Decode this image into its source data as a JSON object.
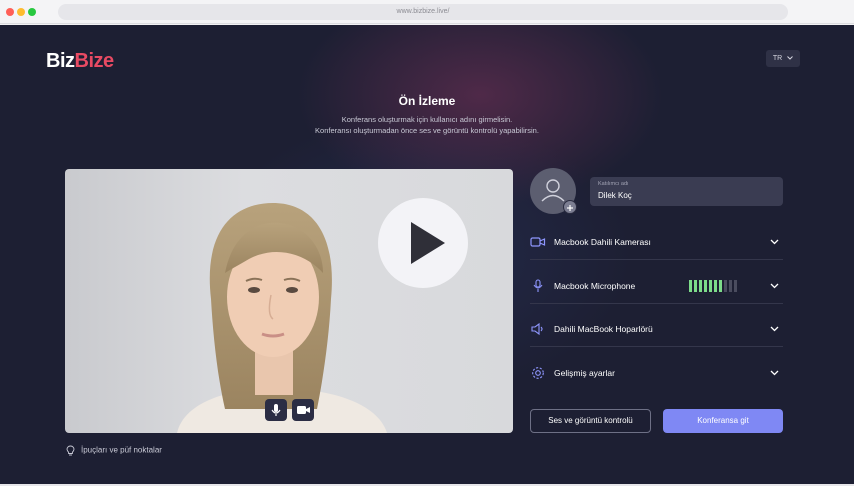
{
  "browser": {
    "url": "www.bizbize.live/"
  },
  "header": {
    "logo_part1": "Biz",
    "logo_part2": "Bize",
    "language": "TR"
  },
  "preview": {
    "title": "Ön İzleme",
    "subtitle_line1": "Konferans oluşturmak için kullanıcı adını girmelisin.",
    "subtitle_line2": "Konferansı oluşturmadan önce ses ve görüntü kontrolü yapabilirsin."
  },
  "name_field": {
    "label": "Katılımcı adı",
    "value": "Dilek Koç"
  },
  "devices": {
    "camera": "Macbook Dahili Kamerası",
    "microphone": "Macbook Microphone",
    "speaker": "Dahili MacBook Hoparlörü",
    "advanced": "Gelişmiş ayarlar"
  },
  "mic_level": {
    "active_bars": 7,
    "total_bars": 10
  },
  "colors": {
    "accent": "#7f88f4",
    "meter_active": "#7ddc8a",
    "meter_inactive": "#4a4c5e"
  },
  "tips": {
    "label": "İpuçları ve püf noktalar"
  },
  "buttons": {
    "check": "Ses ve görüntü kontrolü",
    "join": "Konferansa git"
  },
  "icons": [
    "camera-icon",
    "microphone-icon",
    "speaker-icon",
    "gear-icon",
    "chevron-down-icon",
    "play-icon",
    "lightbulb-icon",
    "user-icon",
    "plus-icon"
  ]
}
